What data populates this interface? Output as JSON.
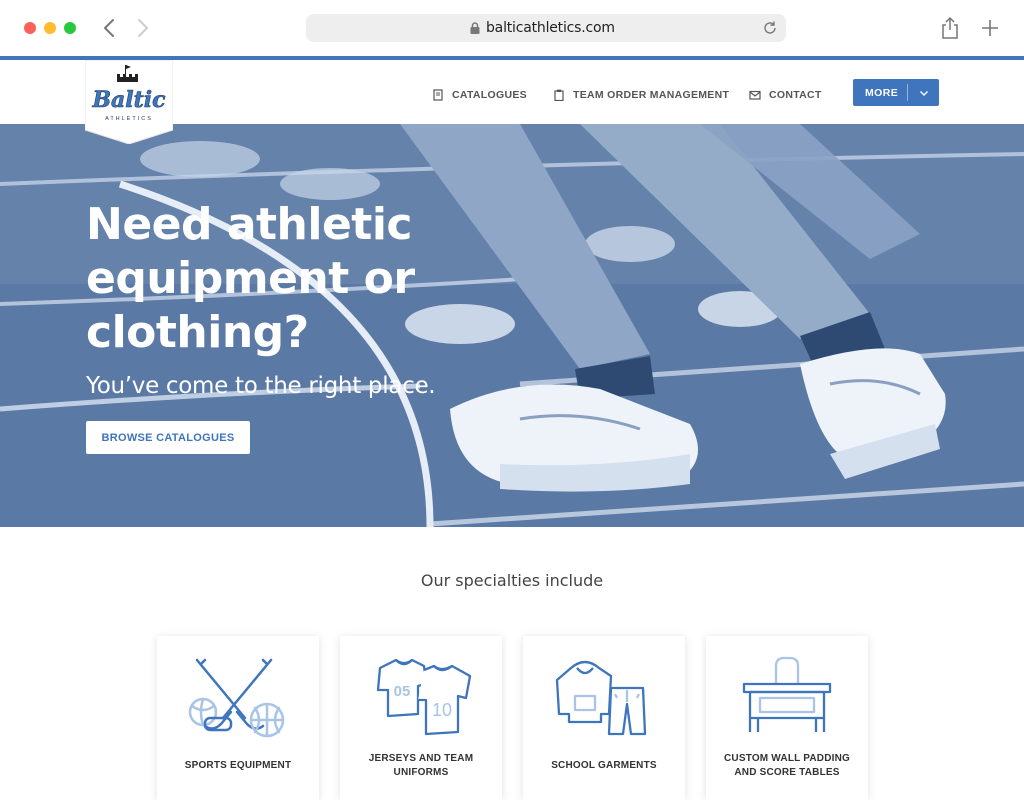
{
  "browser": {
    "url": "balticathletics.com"
  },
  "header": {
    "logo_text": "Baltic",
    "logo_subtext": "ATHLETICS",
    "nav": {
      "catalogues": "CATALOGUES",
      "team_order": "TEAM ORDER MANAGEMENT",
      "contact": "CONTACT",
      "more": "MORE"
    }
  },
  "hero": {
    "title": "Need athletic equipment or clothing?",
    "subtitle": "You’ve come to the right place.",
    "button": "BROWSE CATALOGUES"
  },
  "specialties": {
    "heading": "Our specialties include",
    "cards": [
      {
        "label": "SPORTS EQUIPMENT",
        "icon": "sports-equipment-icon"
      },
      {
        "label": "JERSEYS AND TEAM UNIFORMS",
        "icon": "jerseys-icon"
      },
      {
        "label": "SCHOOL GARMENTS",
        "icon": "garments-icon"
      },
      {
        "label": "CUSTOM WALL PADDING AND SCORE TABLES",
        "icon": "score-table-icon"
      }
    ],
    "jersey_numbers": [
      "05",
      "10"
    ]
  },
  "colors": {
    "brand_blue": "#3e75bd",
    "icon_light_blue": "#a8c4e6"
  }
}
